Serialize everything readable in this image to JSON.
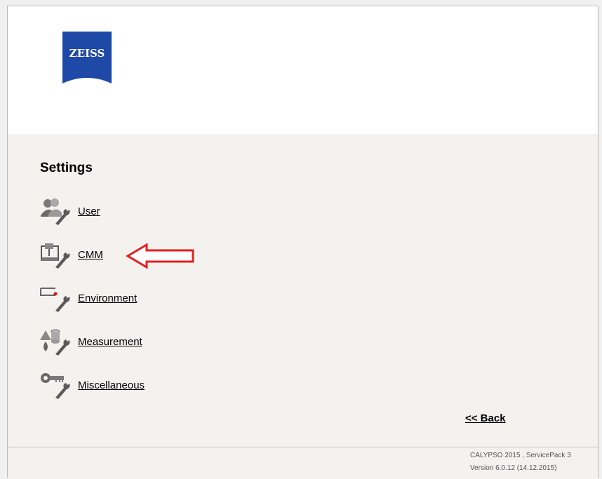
{
  "header": {
    "logo_text": "ZEISS",
    "logo_icon": "zeiss-logo",
    "brand_color": "#1f49a6"
  },
  "main": {
    "title": "Settings",
    "items": [
      {
        "label": "User",
        "icon": "user-settings-icon"
      },
      {
        "label": "CMM",
        "icon": "cmm-settings-icon"
      },
      {
        "label": "Environment",
        "icon": "environment-settings-icon"
      },
      {
        "label": "Measurement",
        "icon": "measurement-settings-icon"
      },
      {
        "label": "Miscellaneous",
        "icon": "miscellaneous-settings-icon"
      }
    ],
    "annotation": {
      "icon": "red-arrow-icon",
      "color": "#e02020"
    },
    "back_label": "<< Back"
  },
  "footer": {
    "line1": "CALYPSO 2015 , ServicePack 3",
    "line2": "Version 6.0.12 (14.12.2015)"
  }
}
